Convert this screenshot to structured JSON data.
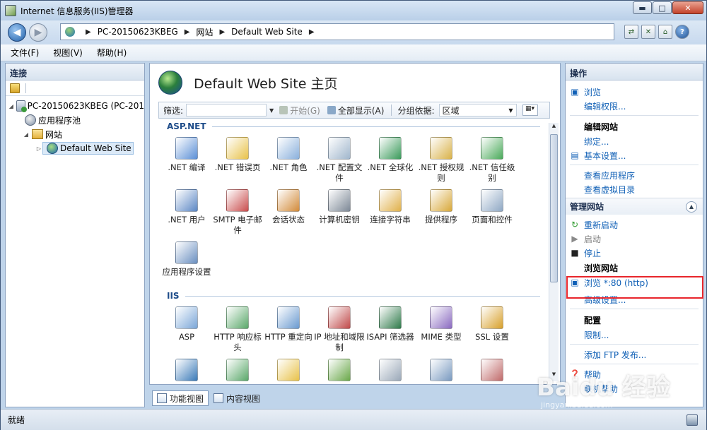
{
  "window": {
    "title": "Internet 信息服务(IIS)管理器",
    "controls": {
      "minimize": "▬",
      "maximize": "□",
      "close": "✕"
    }
  },
  "address": {
    "segments": [
      "PC-20150623KBEG",
      "网站",
      "Default Web Site"
    ]
  },
  "menu": [
    "文件(F)",
    "视图(V)",
    "帮助(H)"
  ],
  "connections": {
    "header": "连接",
    "tree": [
      {
        "label": "PC-20150623KBEG (PC-201",
        "toggle": "◢"
      },
      {
        "label": "应用程序池",
        "toggle": ""
      },
      {
        "label": "网站",
        "toggle": "◢"
      },
      {
        "label": "Default Web Site",
        "toggle": "▷"
      }
    ]
  },
  "center": {
    "title": "Default Web Site 主页",
    "filter": {
      "label": "筛选:",
      "start": "开始(G)",
      "show_all": "全部显示(A)",
      "group_by": "分组依据:",
      "group_value": "区域"
    },
    "groups": [
      {
        "name": "ASP.NET",
        "items": [
          {
            "label": ".NET 编译",
            "color": "#5b8fd6"
          },
          {
            "label": ".NET 错误页",
            "color": "#e8c24a"
          },
          {
            "label": ".NET 角色",
            "color": "#8ab0dc"
          },
          {
            "label": ".NET 配置文件",
            "color": "#a0b6cc"
          },
          {
            "label": ".NET 全球化",
            "color": "#3a9a5a"
          },
          {
            "label": ".NET 授权规则",
            "color": "#d9b24a"
          },
          {
            "label": ".NET 信任级别",
            "color": "#4aaa5a"
          },
          {
            "label": ".NET 用户",
            "color": "#5c87c4"
          },
          {
            "label": "SMTP 电子邮件",
            "color": "#c94d4d"
          },
          {
            "label": "会话状态",
            "color": "#d28b3a"
          },
          {
            "label": "计算机密钥",
            "color": "#7d8896"
          },
          {
            "label": "连接字符串",
            "color": "#e0b04a"
          },
          {
            "label": "提供程序",
            "color": "#d8a83a"
          },
          {
            "label": "页面和控件",
            "color": "#8fa8c4"
          },
          {
            "label": "应用程序设置",
            "color": "#6a8fc0"
          }
        ]
      },
      {
        "name": "IIS",
        "items": [
          {
            "label": "ASP",
            "color": "#7aa6d8"
          },
          {
            "label": "HTTP 响应标头",
            "color": "#5aa86a"
          },
          {
            "label": "HTTP 重定向",
            "color": "#6a9ad0"
          },
          {
            "label": "IP 地址和域限制",
            "color": "#c04a4a"
          },
          {
            "label": "ISAPI 筛选器",
            "color": "#2f7a4a"
          },
          {
            "label": "MIME 类型",
            "color": "#8a6ac0"
          },
          {
            "label": "SSL 设置",
            "color": "#d8a02a"
          }
        ]
      }
    ],
    "more_row_colors": [
      "#3a7ab8",
      "#5aa86a",
      "#e8c24a",
      "#6aa84a",
      "#9aa8b8",
      "#7a9ac0",
      "#c06a6a"
    ],
    "view_tabs": [
      "功能视图",
      "内容视图"
    ]
  },
  "actions": {
    "header": "操作",
    "browse": "浏览",
    "edit_perms": "编辑权限...",
    "edit_site_head": "编辑网站",
    "bindings": "绑定...",
    "basic_settings": "基本设置...",
    "view_apps": "查看应用程序",
    "view_vdirs": "查看虚拟目录",
    "manage_site": "管理网站",
    "restart": "重新启动",
    "start": "启动",
    "stop": "停止",
    "browse_site_head": "浏览网站",
    "browse_80": "浏览 *:80 (http)",
    "advanced": "高级设置...",
    "config_head": "配置",
    "limits": "限制...",
    "add_ftp": "添加 FTP 发布...",
    "help": "帮助",
    "online_help": "联机帮助"
  },
  "status": {
    "text": "就绪"
  },
  "watermark": {
    "text": "Baidu 经验",
    "sub": "jingyan.baidu.com"
  }
}
